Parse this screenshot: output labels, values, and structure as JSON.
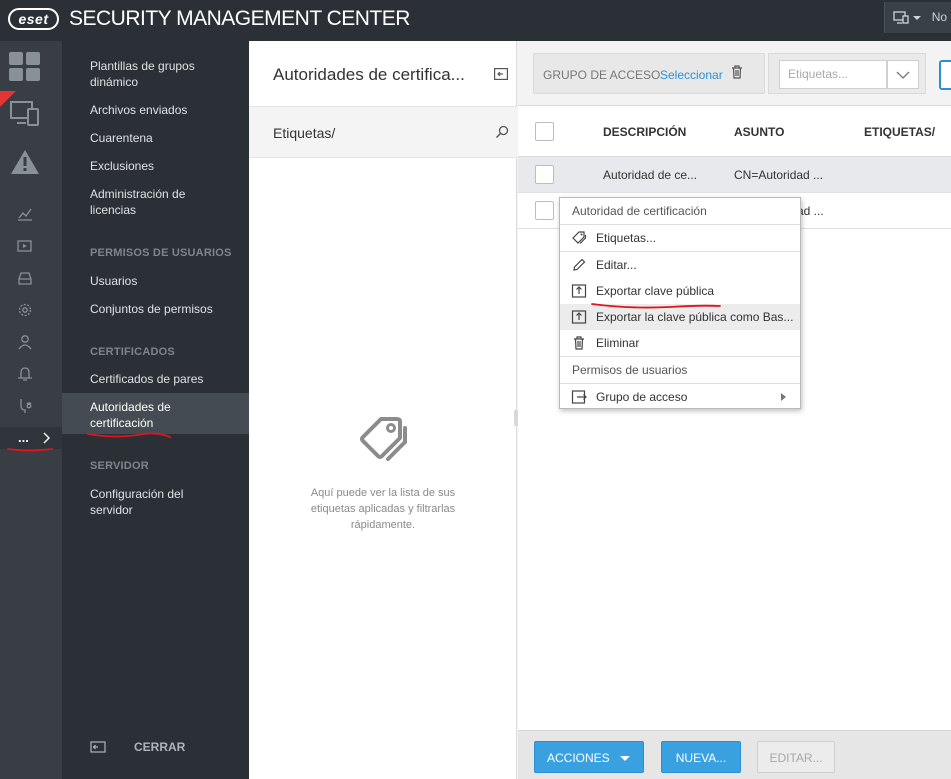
{
  "header": {
    "logo_text": "eset",
    "app_title": "SECURITY MANAGEMENT CENTER",
    "right_selector_text": "No"
  },
  "rail": {
    "icons": [
      "dashboard-icon",
      "computers-icon",
      "detections-icon",
      "reports-icon",
      "tasks-icon",
      "installers-icon",
      "policies-icon",
      "users-icon",
      "notifications-icon",
      "status-icon",
      "more-icon"
    ],
    "more_label": "...",
    "accent_color": "#e53434"
  },
  "nav": {
    "items_top": [
      {
        "label": "Plantillas de grupos dinámico"
      },
      {
        "label": "Archivos enviados"
      },
      {
        "label": "Cuarentena"
      },
      {
        "label": "Exclusiones"
      },
      {
        "label": "Administración de licencias"
      }
    ],
    "section_users": "PERMISOS DE USUARIOS",
    "users_items": [
      {
        "label": "Usuarios"
      },
      {
        "label": "Conjuntos de permisos"
      }
    ],
    "section_certs": "CERTIFICADOS",
    "certs_items": [
      {
        "label": "Certificados de pares"
      },
      {
        "label": "Autoridades de certificación"
      }
    ],
    "section_server": "SERVIDOR",
    "server_items": [
      {
        "label": "Configuración del servidor"
      }
    ],
    "close_label": "CERRAR"
  },
  "tags_panel": {
    "title": "Autoridades de certifica...",
    "search_label": "Etiquetas/",
    "empty_text": "Aquí puede ver la lista de sus etiquetas aplicadas y filtrarlas rápidamente."
  },
  "toolbar": {
    "access_group_label": "GRUPO DE ACCESO",
    "select_link": "Seleccionar",
    "tags_placeholder": "Etiquetas..."
  },
  "table": {
    "columns": [
      "DESCRIPCIÓN",
      "ASUNTO",
      "ETIQUETAS/"
    ],
    "rows": [
      {
        "description": "Autoridad de ce...",
        "subject": "CN=Autoridad ..."
      },
      {
        "description": "",
        "subject": "ad ..."
      }
    ]
  },
  "context_menu": {
    "header": "Autoridad de certificación",
    "items": [
      {
        "label": "Etiquetas...",
        "icon": "tag-icon"
      },
      {
        "label": "Editar...",
        "icon": "pencil-icon"
      },
      {
        "label": "Exportar clave pública",
        "icon": "export-icon"
      },
      {
        "label": "Exportar la clave pública como Bas...",
        "icon": "export-icon"
      },
      {
        "label": "Eliminar",
        "icon": "trash-icon"
      }
    ],
    "section2": "Permisos de usuarios",
    "access_group": "Grupo de acceso"
  },
  "bottom": {
    "actions": "ACCIONES",
    "new": "NUEVA...",
    "edit": "EDITAR..."
  },
  "colors": {
    "accent_blue": "#2b8fd6",
    "annotation_red": "#e0141e",
    "dark_bg": "#2b3036"
  }
}
